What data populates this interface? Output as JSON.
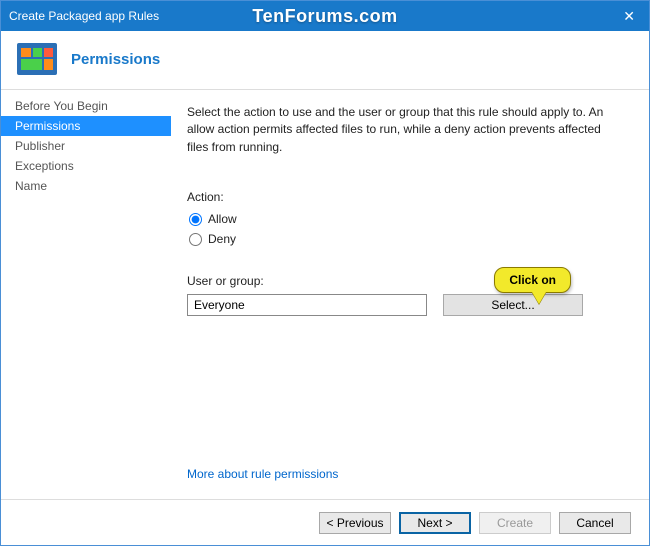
{
  "window": {
    "title": "Create Packaged app Rules",
    "watermark": "TenForums.com"
  },
  "header": {
    "title": "Permissions"
  },
  "sidebar": {
    "items": [
      {
        "label": "Before You Begin"
      },
      {
        "label": "Permissions"
      },
      {
        "label": "Publisher"
      },
      {
        "label": "Exceptions"
      },
      {
        "label": "Name"
      }
    ],
    "active_index": 1
  },
  "main": {
    "description": "Select the action to use and the user or group that this rule should apply to. An allow action permits affected files to run, while a deny action prevents affected files from running.",
    "action_label": "Action:",
    "radios": {
      "allow": "Allow",
      "deny": "Deny",
      "selected": "allow"
    },
    "user_group_label": "User or group:",
    "user_group_value": "Everyone",
    "select_button": "Select...",
    "callout": "Click on",
    "more_link": "More about rule permissions"
  },
  "footer": {
    "previous": "< Previous",
    "next": "Next >",
    "create": "Create",
    "cancel": "Cancel"
  }
}
